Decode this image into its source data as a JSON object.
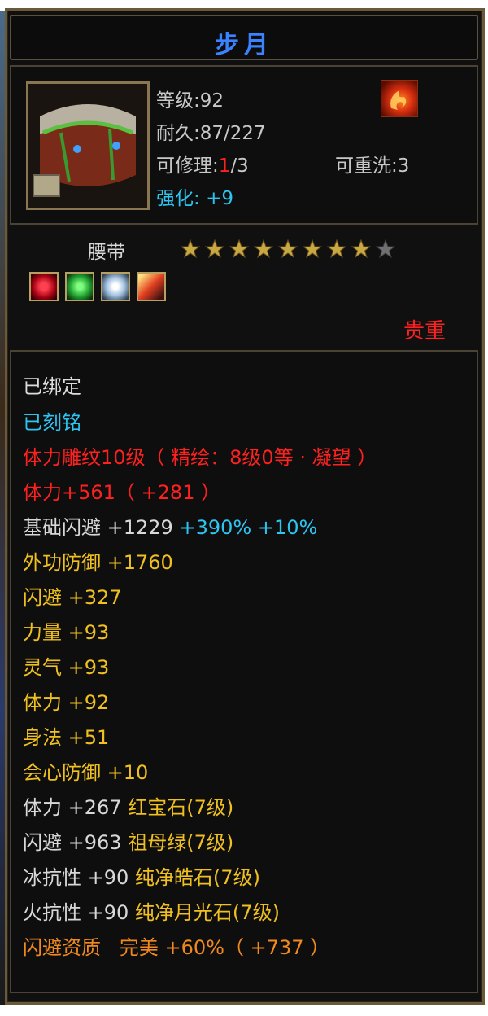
{
  "title": "步月",
  "item": {
    "level_label": "等级",
    "level_value": "92",
    "durability_label": "耐久",
    "durability_value": "87/227",
    "repair_label": "可修理",
    "repair_current": "1",
    "repair_max": "/3",
    "rewash_label": "可重洗",
    "rewash_value": "3",
    "enhance_label": "强化",
    "enhance_value": "+9",
    "type": "腰带",
    "rarity": "贵重",
    "stars_filled": 8,
    "stars_total": 9,
    "gem_slots": [
      "red-gem-icon",
      "green-gem-icon",
      "white-gem-icon",
      "moon-gem-icon"
    ]
  },
  "attributes": {
    "bound": "已绑定",
    "engraved": "已刻铭",
    "carving": "体力雕纹10级（ 精绘：8级0等 · 凝望 ）",
    "stamina_main": "体力+561（ +281 ）",
    "base_dodge_label": "基础闪避",
    "base_dodge_value": "+1229",
    "base_dodge_bonus1": "+390%",
    "base_dodge_bonus2": "+10%",
    "rows": [
      {
        "label": "外功防御",
        "value": "+1760"
      },
      {
        "label": "闪避",
        "value": "+327"
      },
      {
        "label": "力量",
        "value": "+93"
      },
      {
        "label": "灵气",
        "value": "+93"
      },
      {
        "label": "体力",
        "value": "+92"
      },
      {
        "label": "身法",
        "value": "+51"
      },
      {
        "label": "会心防御",
        "value": "+10"
      }
    ],
    "gems": [
      {
        "label": "体力",
        "value": "+267",
        "gem": "红宝石(7级)"
      },
      {
        "label": "闪避",
        "value": "+963",
        "gem": "祖母绿(7级)"
      },
      {
        "label": "冰抗性",
        "value": "+90",
        "gem": "纯净皓石(7级)"
      },
      {
        "label": "火抗性",
        "value": "+90",
        "gem": "纯净月光石(7级)"
      }
    ],
    "quality_label": "闪避资质",
    "quality_grade": "完美",
    "quality_value": "+60%（ +737 ）"
  },
  "colors": {
    "title": "#3a82ff",
    "cyan": "#2ec4f0",
    "red": "#ff2020",
    "gold": "#f0c020",
    "orange": "#f08a20"
  }
}
